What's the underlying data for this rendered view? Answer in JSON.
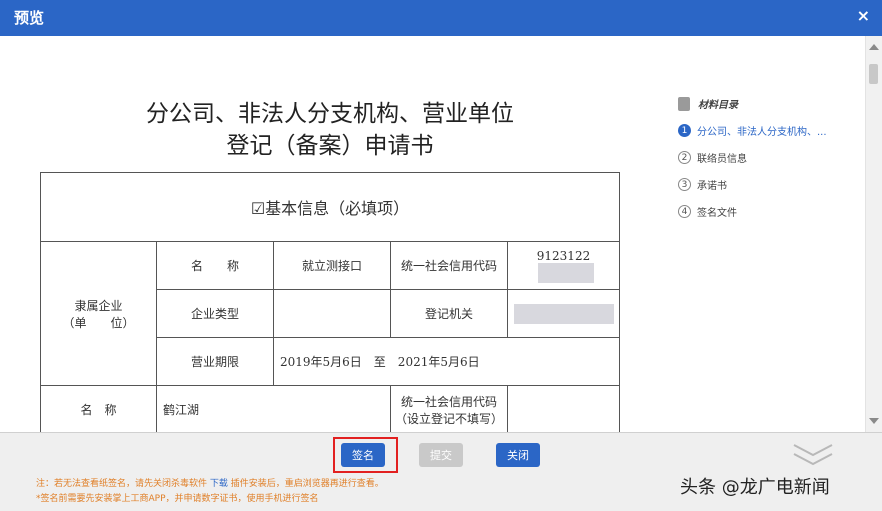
{
  "window": {
    "title": "预览",
    "close_icon": "×"
  },
  "document": {
    "title_line1": "分公司、非法人分支机构、营业单位",
    "title_line2": "登记（备案）申请书",
    "section_header": "☑基本信息（必填项）",
    "parent_group_label": "隶属企业\n（单　　位）",
    "rows": {
      "name_label": "名　　称",
      "name_value": "就立测接口",
      "credit_code_label": "统一社会信用代码",
      "credit_code_value": "9123122",
      "company_type_label": "企业类型",
      "company_type_value": "",
      "registry_label": "登记机关",
      "registry_value": "",
      "business_term_label": "营业期限",
      "business_term_value": "2019年5月6日　至　2021年5月6日",
      "branch_name_label": "名　称",
      "branch_name_value": "鹤江湖",
      "branch_credit_label": "统一社会信用代码\n（设立登记不填写）"
    }
  },
  "sidebar": {
    "title": "材料目录",
    "items": [
      {
        "num": "1",
        "label": "分公司、非法人分支机构、..."
      },
      {
        "num": "2",
        "label": "联络员信息"
      },
      {
        "num": "3",
        "label": "承诺书"
      },
      {
        "num": "4",
        "label": "签名文件"
      }
    ]
  },
  "footer": {
    "sign_label": "签名",
    "submit_label": "提交",
    "close_label": "关闭",
    "note_line1_prefix": "注：若无法查看纸签名，请先关闭杀毒软件",
    "note_line1_link": "下载",
    "note_line1_suffix": "插件安装后，重启浏览器再进行查看。",
    "note_line2": "*签名前需要先安装掌上工商APP，并申请数字证书，使用手机进行签名"
  },
  "watermark": "头条 @龙广电新闻",
  "colors": {
    "accent": "#2b66c6",
    "highlight": "#e22020",
    "note": "#e0802a"
  }
}
